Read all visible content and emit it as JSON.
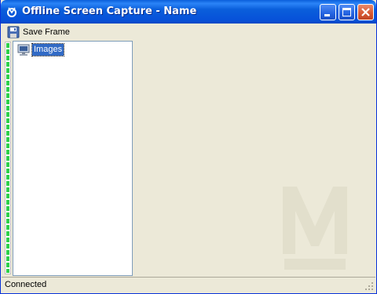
{
  "window": {
    "title": "Offline Screen Capture - Name",
    "app_icon": "capture-app-icon"
  },
  "title_buttons": [
    {
      "name": "minimize",
      "icon": "minimize-icon"
    },
    {
      "name": "maximize",
      "icon": "maximize-icon"
    },
    {
      "name": "close",
      "icon": "close-icon"
    }
  ],
  "toolbar": {
    "save_label": "Save Frame",
    "save_icon": "floppy-disk-icon"
  },
  "tree": {
    "items": [
      {
        "label": "Images",
        "icon": "monitor-icon",
        "selected": true
      }
    ]
  },
  "status": {
    "text": "Connected"
  },
  "colors": {
    "titlebar": "#0a5fdb",
    "selection": "#316ac5",
    "progress": "#2fd04a",
    "face": "#ece9d8"
  }
}
